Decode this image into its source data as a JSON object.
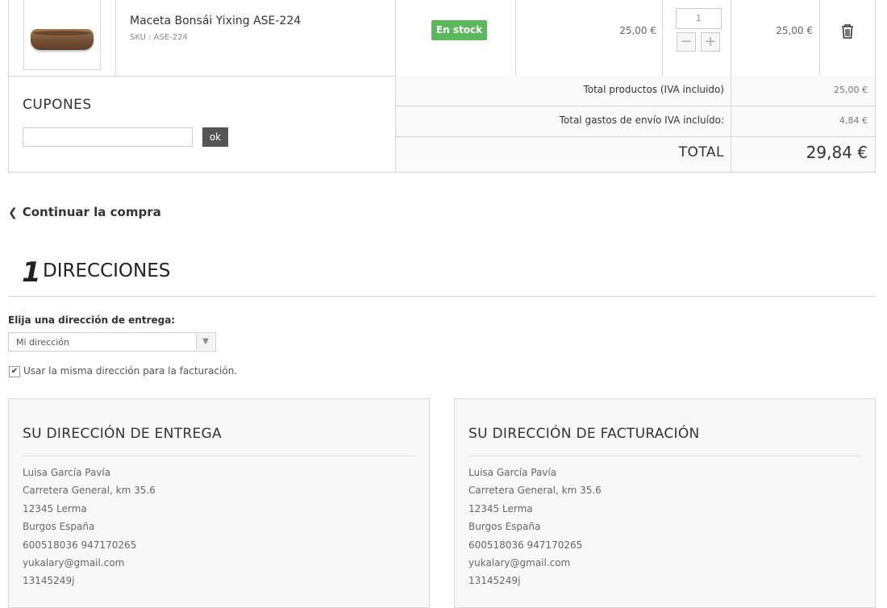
{
  "cart": {
    "product": {
      "name": "Maceta Bonsái Yixing ASE-224",
      "sku": "SKU : ASE-224",
      "stock": "En stock",
      "unit_price": "25,00 €",
      "quantity": "1",
      "total": "25,00 €"
    }
  },
  "coupons": {
    "title": "CUPONES",
    "input_value": "",
    "button": "ok"
  },
  "totals": {
    "products_label": "Total productos (IVA incluido)",
    "products_value": "25,00 €",
    "shipping_label": "Total gastos de envío IVA incluído:",
    "shipping_value": "4,84 €",
    "total_label": "TOTAL",
    "total_value": "29,84 €"
  },
  "continue_label": "Continuar la compra",
  "step": {
    "number": "1",
    "title": "DIRECCIONES"
  },
  "delivery": {
    "choose_label": "Elija una dirección de entrega:",
    "selected": "Mi dirección",
    "same_billing_label": "Usar la misma dirección para la facturación.",
    "same_billing_checked": true
  },
  "delivery_address": {
    "title": "SU DIRECCIÓN DE ENTREGA",
    "lines": [
      "Luisa García Pavía",
      "Carretera General, km 35.6",
      "12345 Lerma",
      "Burgos España",
      "600518036 947170265",
      "yukalary@gmail.com",
      "13145249j"
    ]
  },
  "billing_address": {
    "title": "SU DIRECCIÓN DE FACTURACIÓN",
    "lines": [
      "Luisa García Pavía",
      "Carretera General, km 35.6",
      "12345 Lerma",
      "Burgos España",
      "600518036 947170265",
      "yukalary@gmail.com",
      "13145249j"
    ]
  },
  "icons": {
    "trash": "trash-icon",
    "chevron": "chevron-left-icon",
    "dropdown": "caret-down-icon",
    "check": "check-icon"
  },
  "colors": {
    "stock_badge": "#5cb85c",
    "ok_button": "#555555",
    "border": "#d6d6d6"
  }
}
